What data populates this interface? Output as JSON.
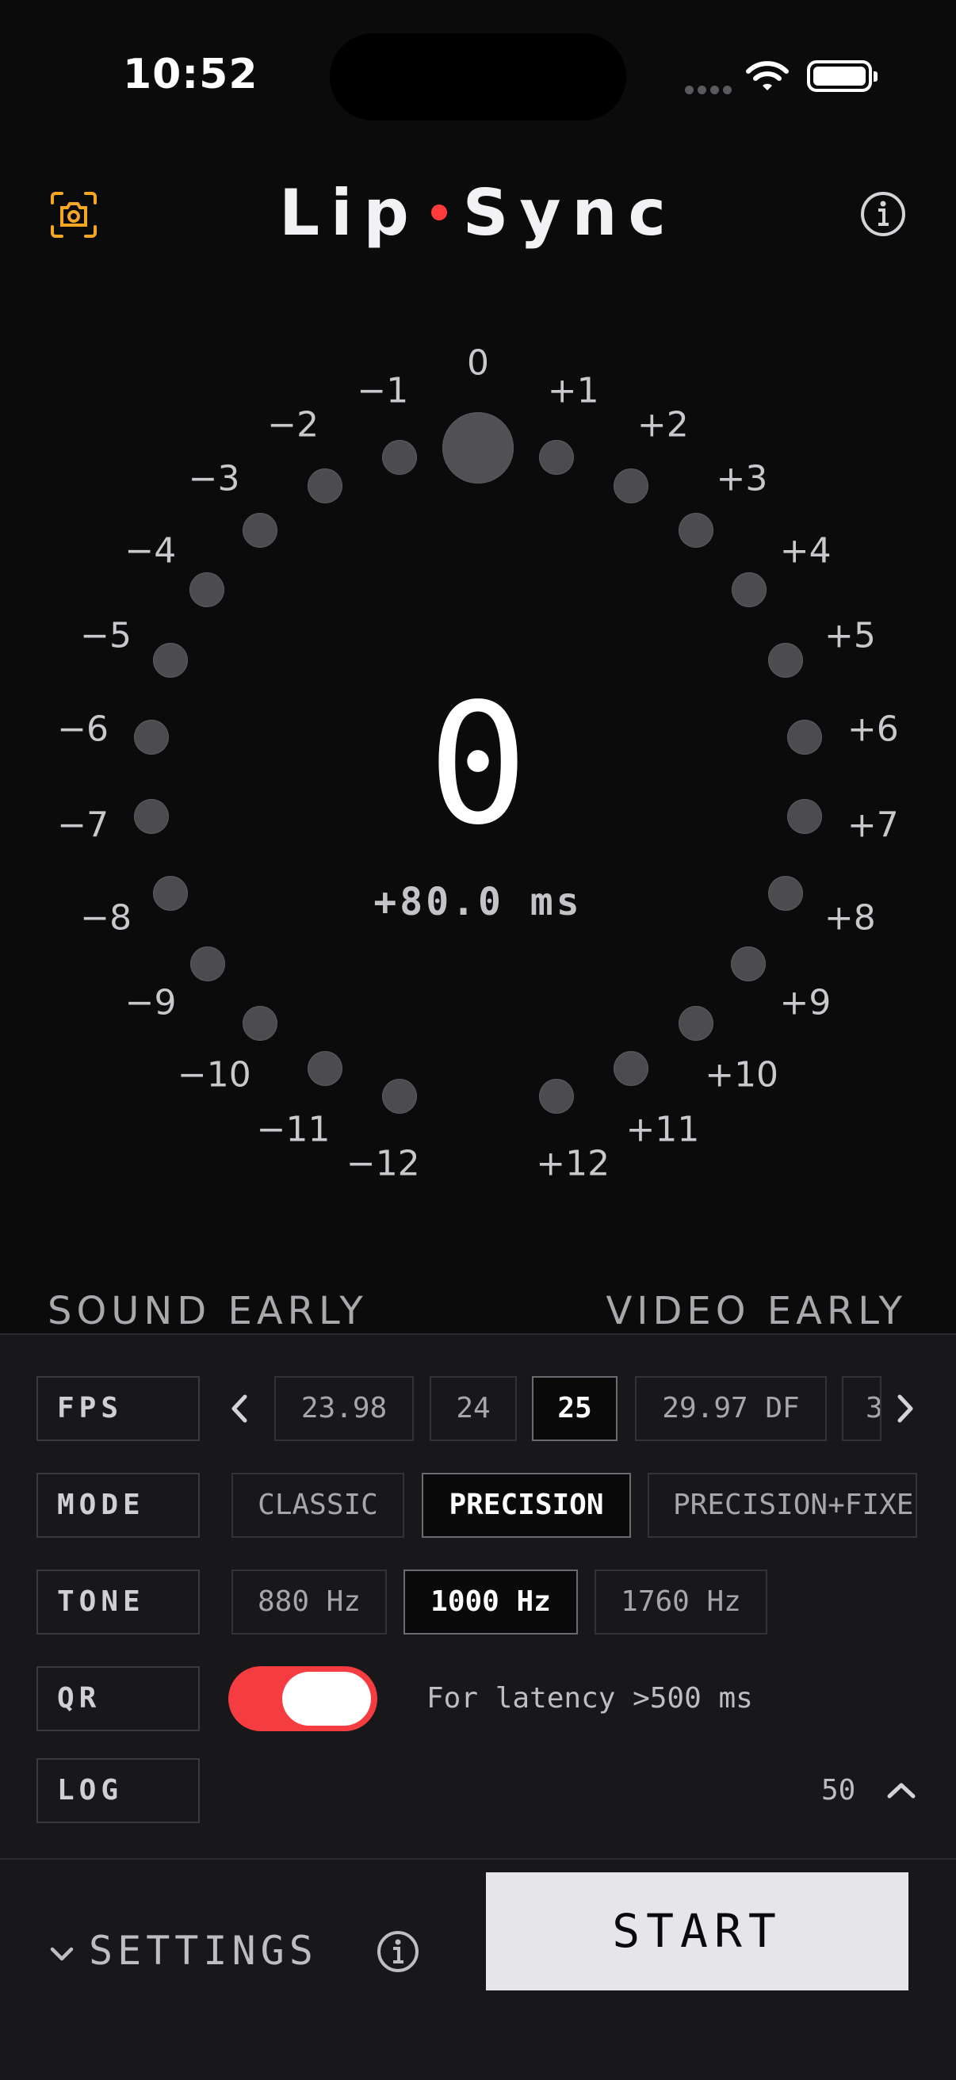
{
  "status_bar": {
    "time": "10:52"
  },
  "header": {
    "title_left": "Lip",
    "title_right": "Sync"
  },
  "dial": {
    "value": "0",
    "offset_label": "+80.0 ms",
    "labels": [
      "−12",
      "−11",
      "−10",
      "−9",
      "−8",
      "−7",
      "−6",
      "−5",
      "−4",
      "−3",
      "−2",
      "−1",
      "0",
      "+1",
      "+2",
      "+3",
      "+4",
      "+5",
      "+6",
      "+7",
      "+8",
      "+9",
      "+10",
      "+11",
      "+12"
    ],
    "selected_index": 12
  },
  "axis": {
    "left": "SOUND EARLY",
    "right": "VIDEO EARLY"
  },
  "settings": {
    "fps": {
      "label": "FPS",
      "options": [
        "23.98",
        "24",
        "25",
        "29.97 DF",
        "3"
      ],
      "selected": "25"
    },
    "mode": {
      "label": "MODE",
      "options": [
        "CLASSIC",
        "PRECISION",
        "PRECISION+FIXE"
      ],
      "selected": "PRECISION"
    },
    "tone": {
      "label": "TONE",
      "options": [
        "880 Hz",
        "1000 Hz",
        "1760 Hz"
      ],
      "selected": "1000 Hz"
    },
    "qr": {
      "label": "QR",
      "enabled": true,
      "note": "For latency >500 ms"
    },
    "log": {
      "label": "LOG",
      "count": "50"
    }
  },
  "bottom": {
    "settings_label": "SETTINGS",
    "start_label": "START"
  },
  "colors": {
    "accent_red": "#f53c40",
    "camera_orange": "#f5a623",
    "background": "#0b0b0c",
    "panel": "#18181a"
  },
  "icons": [
    "camera-icon",
    "info-icon",
    "chevron-left-icon",
    "chevron-right-icon",
    "chevron-up-icon",
    "chevron-down-icon",
    "wifi-icon",
    "battery-icon"
  ]
}
